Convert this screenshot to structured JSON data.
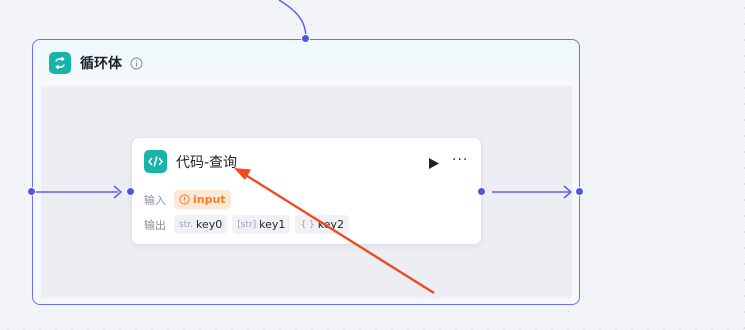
{
  "loop": {
    "title": "循环体",
    "icon": "loop-icon",
    "info_icon": "info-icon"
  },
  "code_node": {
    "title": "代码-查询",
    "icon": "code-icon",
    "input_label": "输入",
    "output_label": "输出",
    "inputs": [
      {
        "name": "input",
        "icon": "warning-icon"
      }
    ],
    "outputs": [
      {
        "type": "str.",
        "name": "key0"
      },
      {
        "type": "[str]",
        "name": "key1"
      },
      {
        "type": "{ }",
        "name": "key2"
      }
    ],
    "run_icon": "play-icon",
    "more": "···"
  },
  "colors": {
    "accent": "#4f56e6",
    "node_icon_bg": "#16b4a9",
    "input_chip_bg": "#fde7d8",
    "input_chip_text": "#f5821f",
    "annotation_arrow": "#f04a1d"
  }
}
